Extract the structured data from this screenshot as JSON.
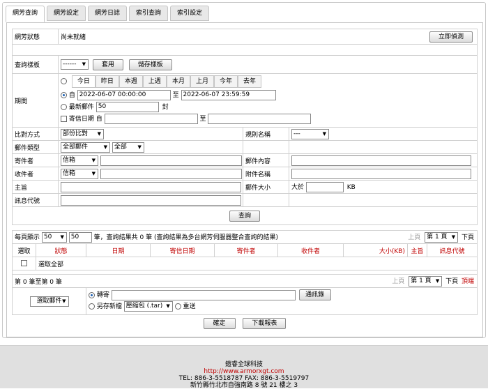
{
  "tabs": [
    "網芳查詢",
    "網芳設定",
    "網芳日誌",
    "索引查詢",
    "索引設定"
  ],
  "status": {
    "label": "網芳狀態",
    "value": "尚未就緒",
    "detect_button": "立即偵測"
  },
  "template": {
    "label": "查詢樣板",
    "select_value": "------",
    "apply_button": "套用",
    "save_button": "儲存樣板"
  },
  "period": {
    "label": "期間",
    "quick_tabs": [
      "今日",
      "昨日",
      "本週",
      "上週",
      "本月",
      "上月",
      "今年",
      "去年"
    ],
    "from_label": "自",
    "from_value": "2022-06-07 00:00:00",
    "to_label": "至",
    "to_value": "2022-06-07 23:59:59",
    "latest_label": "最新郵件",
    "latest_value": "50",
    "latest_unit": "封",
    "sent_date_label": "寄信日期",
    "sent_from": "自",
    "sent_to": "至"
  },
  "criteria": {
    "match_label": "比對方式",
    "match_value": "部份比對",
    "rule_label": "規則名稱",
    "rule_value": "---",
    "type_label": "郵件類型",
    "type_value": "全部郵件",
    "type_value2": "全部",
    "sender_label": "寄件者",
    "sender_select": "信箱",
    "content_label": "郵件內容",
    "recipient_label": "收件者",
    "recipient_select": "信箱",
    "attach_label": "附件名稱",
    "subject_label": "主旨",
    "size_label": "郵件大小",
    "size_gt": "大於",
    "size_unit": "KB",
    "msgid_label": "訊息代號"
  },
  "query_button": "查詢",
  "results": {
    "per_page_label": "每頁顯示",
    "per_page_select": "50",
    "per_page_value": "50",
    "summary": "筆，查詢結果共 0 筆 (查詢結果為多台網芳伺服器整合查詢的結果)",
    "prev": "上頁",
    "page_select": "第 1 頁",
    "next": "下頁",
    "last": "頂端",
    "columns": [
      "選取",
      "狀態",
      "日期",
      "寄信日期",
      "寄件者",
      "收件者",
      "大小(KB)",
      "主旨",
      "訊息代號"
    ],
    "select_all": "選取全部",
    "range_text": "第 0 筆至第 0 筆"
  },
  "actions": {
    "selected_mail": "選取郵件",
    "forward_label": "轉寄",
    "address_book_button": "通訊錄",
    "save_as_label": "另存新檔",
    "archive_select": "壓縮包 (.tar)",
    "resend_label": "重送",
    "confirm_button": "確定",
    "download_report_button": "下載報表"
  },
  "footer": {
    "company": "鎧睿全球科技",
    "url": "http://www.armorxgt.com",
    "phone": "TEL: 886-3-5518787  FAX: 886-3-5519797",
    "address": "新竹縣竹北市自強南路 8 號 21 樓之 3"
  },
  "colors": {
    "accent_red": "#c00000",
    "radio_blue": "#1a5fb4",
    "footer_bg": "#e0e0e0"
  }
}
